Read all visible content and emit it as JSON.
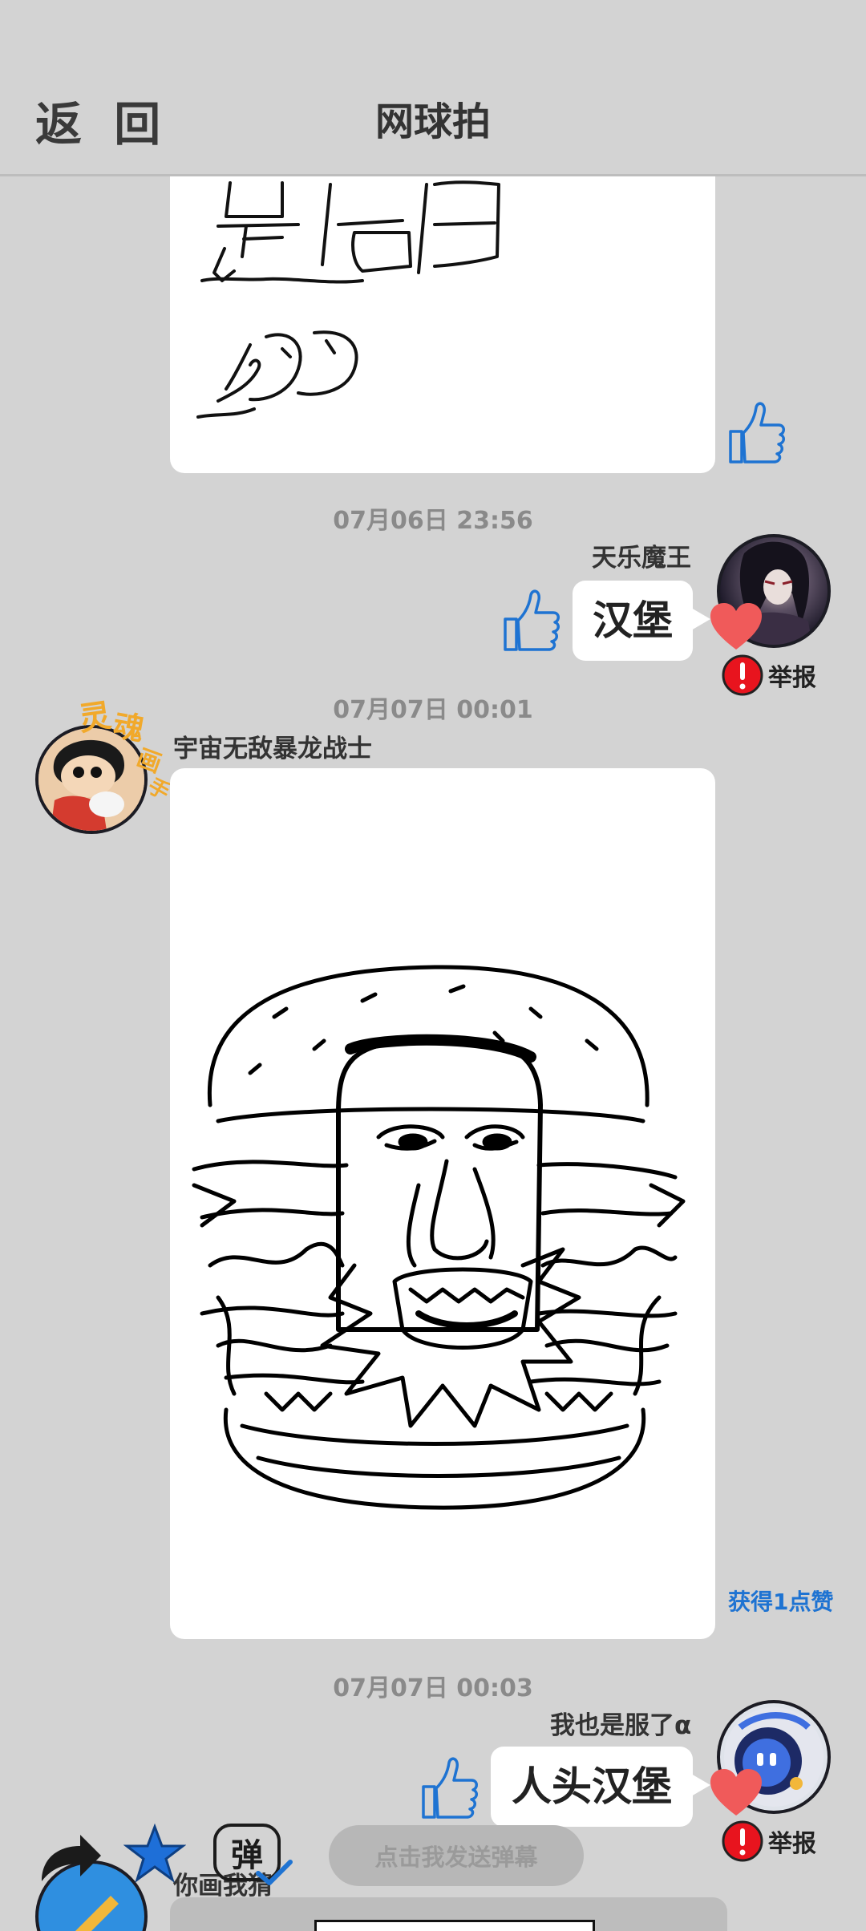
{
  "header": {
    "back_label": "返 回",
    "title": "网球拍"
  },
  "messages": [
    {
      "kind": "drawing",
      "note": "top drawing partially scrolled"
    },
    {
      "kind": "text",
      "timestamp": "07月06日  23:56",
      "user": "天乐魔王",
      "text": "汉堡",
      "report_label": "举报"
    },
    {
      "kind": "drawing",
      "timestamp": "07月07日  00:01",
      "user": "宇宙无敌暴龙战士",
      "likes_text": "获得1点赞",
      "avatar_badge": [
        "灵",
        "魂",
        "画",
        "手"
      ]
    },
    {
      "kind": "text",
      "timestamp": "07月07日  00:03",
      "user": "我也是服了α",
      "text": "人头汉堡",
      "report_label": "举报"
    },
    {
      "kind": "drawing",
      "user": "你画我猜"
    }
  ],
  "toolbar": {
    "danmaku_toggle_label": "弹",
    "send_danmaku_label": "点击我发送弹幕"
  },
  "colors": {
    "background": "#d3d3d3",
    "accent_blue": "#1e73d2",
    "heart": "#f05a5a",
    "report_red": "#e8141e"
  }
}
